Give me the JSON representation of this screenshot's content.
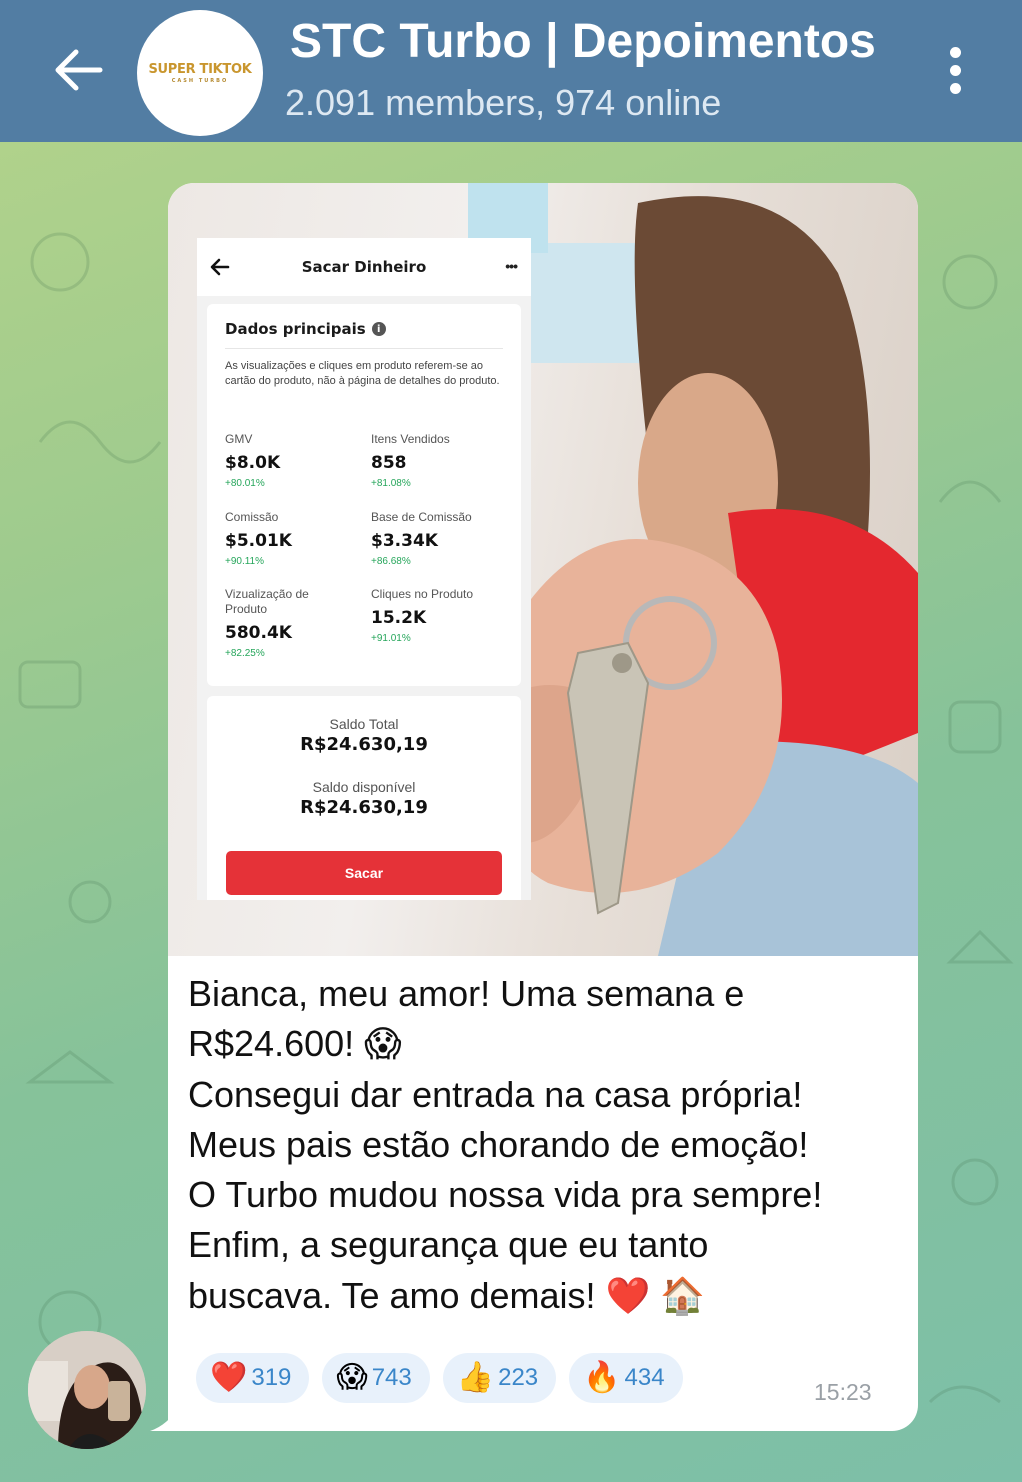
{
  "header": {
    "back_label": "←",
    "avatar_logo_text": "SUPER TIKTOK",
    "avatar_logo_sub": "CASH TURBO",
    "title": "STC Turbo | Depoimentos",
    "subtitle": "2.091 members, 974 online"
  },
  "colors": {
    "header_bg": "#527da3",
    "accent_blue": "#3a86c9",
    "sacar_red": "#e53238",
    "delta_green": "#26a65b"
  },
  "message": {
    "photo": {
      "screen_title": "Sacar Dinheiro",
      "more_label": "•••",
      "card_title": "Dados principais",
      "info_icon": "i",
      "description": "As visualizações e cliques em produto referem-se ao cartão do produto, não à página de detalhes do produto.",
      "metrics": [
        {
          "label": "GMV",
          "value": "$8.0K",
          "delta": "+80.01%"
        },
        {
          "label": "Itens Vendidos",
          "value": "858",
          "delta": "+81.08%"
        },
        {
          "label": "Comissão",
          "value": "$5.01K",
          "delta": "+90.11%"
        },
        {
          "label": "Base de Comissão",
          "value": "$3.34K",
          "delta": "+86.68%"
        },
        {
          "label": "Vizualização de Produto",
          "value": "580.4K",
          "delta": "+82.25%"
        },
        {
          "label": "Cliques no Produto",
          "value": "15.2K",
          "delta": "+91.01%"
        }
      ],
      "saldo_total_label": "Saldo Total",
      "saldo_total_value": "R$24.630,19",
      "saldo_disp_label": "Saldo disponível",
      "saldo_disp_value": "R$24.630,19",
      "sacar_label": "Sacar"
    },
    "text_lines": [
      "Bianca, meu amor! Uma semana e",
      "R$24.600! 😱",
      "Consegui dar entrada na casa própria!",
      "Meus pais estão chorando de emoção!",
      "O Turbo mudou nossa vida pra sempre!",
      "Enfim, a segurança que eu tanto",
      "buscava. Te amo demais! ❤️ 🏠"
    ],
    "reactions": [
      {
        "emoji": "❤️",
        "count": "319"
      },
      {
        "emoji": "😱",
        "count": "743"
      },
      {
        "emoji": "👍",
        "count": "223"
      },
      {
        "emoji": "🔥",
        "count": "434"
      }
    ],
    "time": "15:23"
  }
}
